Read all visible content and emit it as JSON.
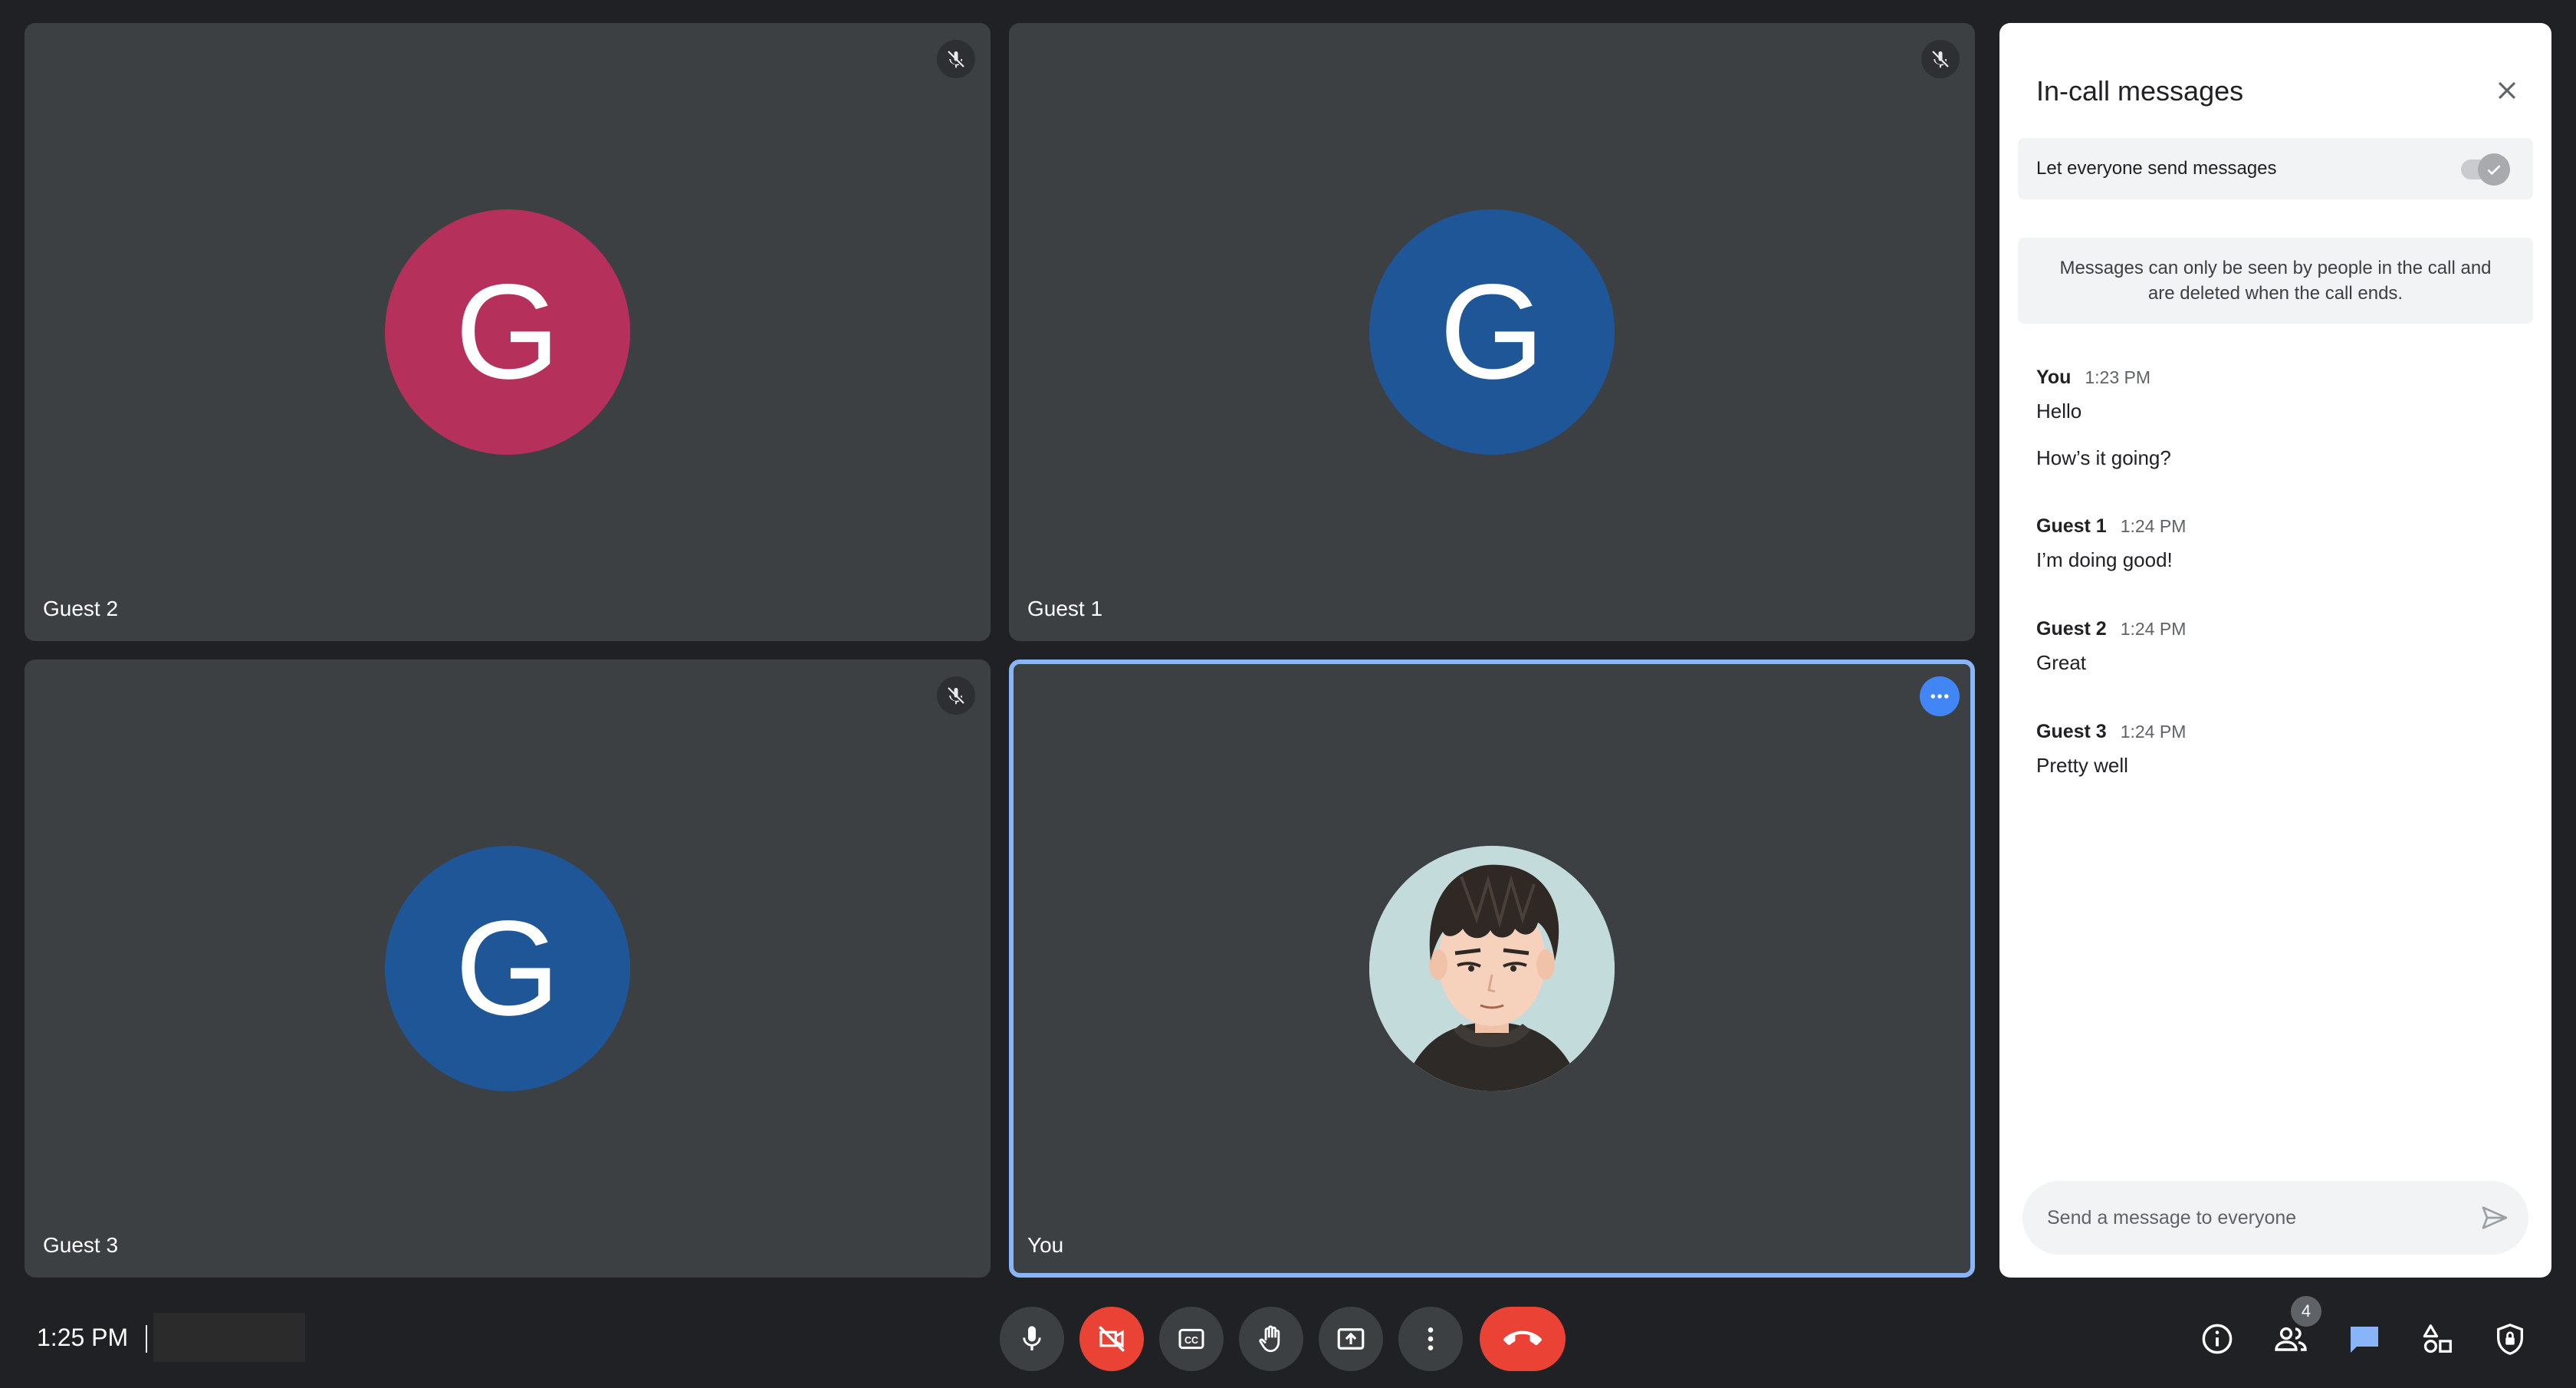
{
  "participants": [
    {
      "name": "Guest 2",
      "initial": "G",
      "color": "#b5305a",
      "muted": true
    },
    {
      "name": "Guest 1",
      "initial": "G",
      "color": "#1f5697",
      "muted": true
    },
    {
      "name": "Guest 3",
      "initial": "G",
      "color": "#1f5697",
      "muted": true
    },
    {
      "name": "You",
      "avatar": "cartoon-portrait",
      "highlighted": true
    }
  ],
  "panel": {
    "title": "In-call messages",
    "toggle_label": "Let everyone send messages",
    "toggle_on": true,
    "info": "Messages can only be seen by people in the call and are deleted when the call ends.",
    "messages": [
      {
        "sender": "You",
        "time": "1:23 PM",
        "lines": [
          "Hello",
          "How’s it going?"
        ]
      },
      {
        "sender": "Guest 1",
        "time": "1:24 PM",
        "lines": [
          "I’m doing good!"
        ]
      },
      {
        "sender": "Guest 2",
        "time": "1:24 PM",
        "lines": [
          "Great"
        ]
      },
      {
        "sender": "Guest 3",
        "time": "1:24 PM",
        "lines": [
          "Pretty well"
        ]
      }
    ],
    "composer_placeholder": "Send a message to everyone"
  },
  "bottom": {
    "time": "1:25 PM",
    "meeting_code": "",
    "controls": [
      "mic-icon",
      "camera-off-icon",
      "captions-icon",
      "raise-hand-icon",
      "present-icon",
      "more-vert-icon",
      "end-call-icon"
    ],
    "right_icons": [
      "info-icon",
      "people-icon",
      "chat-icon",
      "activities-icon",
      "host-controls-icon"
    ],
    "people_count": "4"
  },
  "colors": {
    "background": "#202124",
    "tile": "#3c4043",
    "accent": "#8ab4f8",
    "end_call": "#ea4335",
    "chat_active": "#8ab4f8"
  }
}
